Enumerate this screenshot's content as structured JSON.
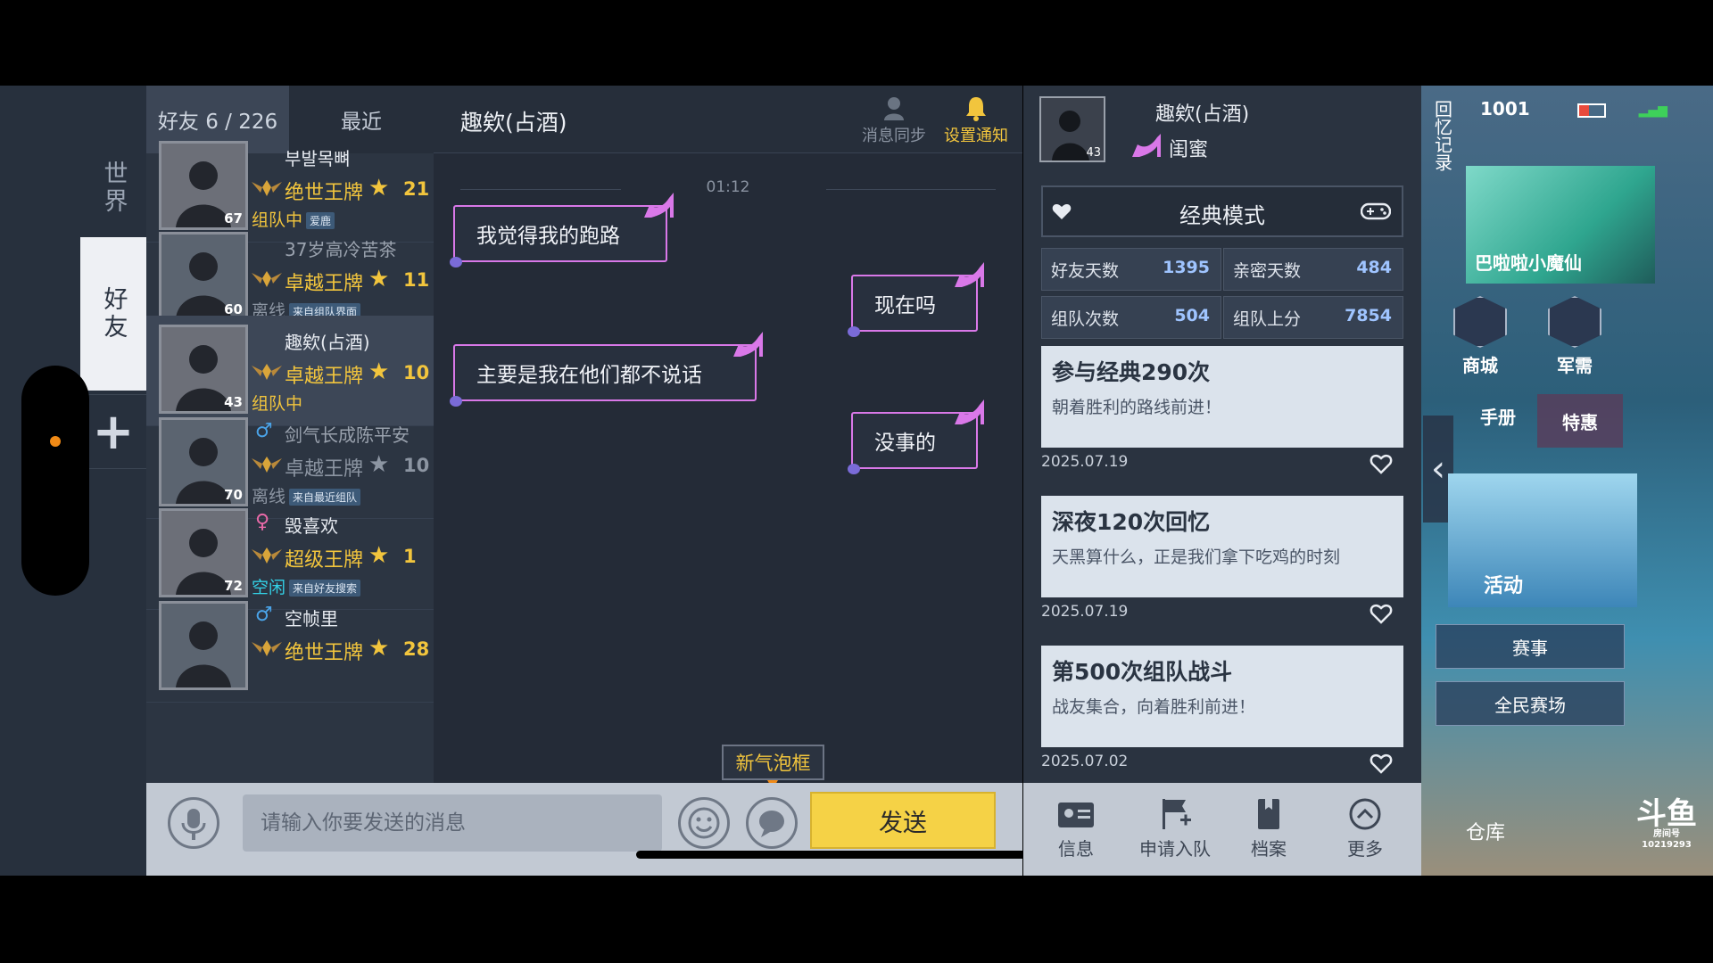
{
  "side_tabs": {
    "world": "世界",
    "friends": "好友",
    "add": "+"
  },
  "friends_tabs": {
    "friends": "好友 6 / 226",
    "recent": "最近"
  },
  "friends": [
    {
      "name": "부발목뼈",
      "gender": "",
      "rank": "绝世王牌",
      "stars": "21",
      "status": "组队中",
      "tag": "爱鹿",
      "level": "67",
      "status_color": "orange",
      "rank_color": "gold",
      "dim": false
    },
    {
      "name": "37岁高冷苦茶",
      "gender": "",
      "rank": "卓越王牌",
      "stars": "11",
      "status": "离线",
      "tag": "来自组队界面",
      "level": "60",
      "status_color": "gray",
      "rank_color": "gold",
      "dim": true
    },
    {
      "name": "趣欸(占酒)",
      "gender": "",
      "rank": "卓越王牌",
      "stars": "10",
      "status": "组队中",
      "tag": "",
      "level": "43",
      "status_color": "orange",
      "rank_color": "gold",
      "dim": false
    },
    {
      "name": "剑气长成陈平安",
      "gender": "♂",
      "rank": "卓越王牌",
      "stars": "10",
      "status": "离线",
      "tag": "来自最近组队",
      "level": "70",
      "status_color": "gray",
      "rank_color": "gray",
      "dim": true
    },
    {
      "name": "毁喜欢",
      "gender": "♀",
      "rank": "超级王牌",
      "stars": "1",
      "status": "空闲",
      "tag": "来自好友搜索",
      "level": "72",
      "status_color": "cyan",
      "rank_color": "gold",
      "dim": false
    },
    {
      "name": "空帧里",
      "gender": "♂",
      "rank": "绝世王牌",
      "stars": "28",
      "status": "",
      "tag": "",
      "level": "",
      "status_color": "gray",
      "rank_color": "gold",
      "dim": false
    }
  ],
  "chat": {
    "title": "趣欸(占酒)",
    "sync_label": "消息同步",
    "notify_label": "设置通知",
    "time": "01:12",
    "messages": [
      {
        "text": "我觉得我的跑路",
        "side": "left"
      },
      {
        "text": "现在吗",
        "side": "right"
      },
      {
        "text": "主要是我在他们都不说话",
        "side": "left"
      },
      {
        "text": "没事的",
        "side": "right"
      }
    ],
    "new_bubble_tag": "新气泡框",
    "input_placeholder": "请输入你要发送的消息",
    "send_label": "发送"
  },
  "profile": {
    "name": "趣欸(占酒)",
    "level": "43",
    "relation": "闺蜜",
    "mode": "经典模式",
    "stats": [
      {
        "label": "好友天数",
        "value": "1395"
      },
      {
        "label": "亲密天数",
        "value": "484"
      },
      {
        "label": "组队次数",
        "value": "504"
      },
      {
        "label": "组队上分",
        "value": "7854"
      }
    ],
    "memories": [
      {
        "title": "参与经典290次",
        "subtitle": "朝着胜利的路线前进！",
        "date": "2025.07.19"
      },
      {
        "title": "深夜120次回忆",
        "subtitle": "天黑算什么，正是我们拿下吃鸡的时刻",
        "date": "2025.07.19"
      },
      {
        "title": "第500次组队战斗",
        "subtitle": "战友集合，向着胜利前进！",
        "date": "2025.07.02"
      }
    ],
    "actions": {
      "info": "信息",
      "apply": "申请入队",
      "archive": "档案",
      "more": "更多"
    }
  },
  "game_hud": {
    "memory_label": "回忆记录",
    "status_value": "1001",
    "event_banner": "巴啦啦小魔仙",
    "shop": "商城",
    "military": "军需",
    "manual": "手册",
    "special": "特惠",
    "activity": "活动",
    "match": "赛事",
    "arena": "全民赛场",
    "warehouse": "仓库",
    "douyu": "斗鱼",
    "room_label": "房间号",
    "room_no": "10219293"
  }
}
